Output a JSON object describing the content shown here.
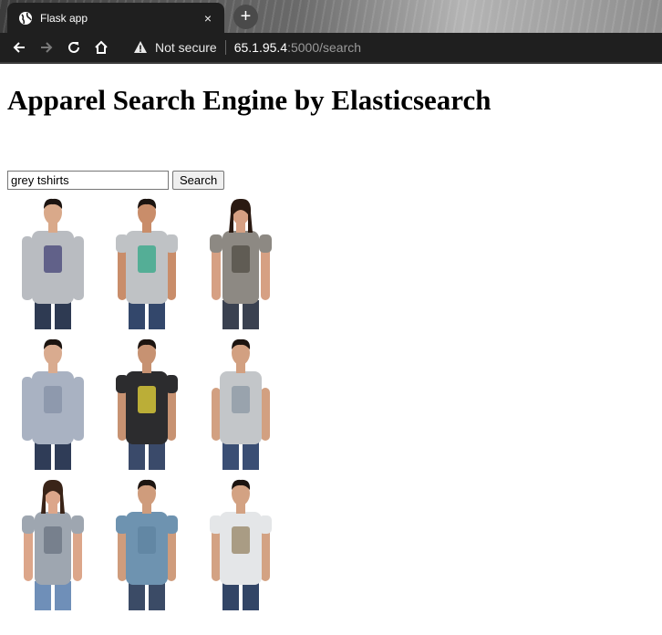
{
  "browser": {
    "tab_title": "Flask app",
    "tab_close": "×",
    "new_tab": "+",
    "security_label": "Not secure",
    "url_host": "65.1.95.4",
    "url_path": ":5000/search"
  },
  "page": {
    "heading": "Apparel Search Engine by Elasticsearch",
    "search": {
      "value": "grey tshirts",
      "button_label": "Search"
    }
  },
  "results": [
    {
      "item": "man-grey-full-sleeve-tee",
      "skin": "#d9a98a",
      "hair": "#1c1410",
      "top": "#b9bcc1",
      "bottom": "#2e3a52",
      "print": "#4b4a7a",
      "sleeve": "long",
      "gender": "m"
    },
    {
      "item": "man-grey-tee-green-graphic",
      "skin": "#c98d6a",
      "hair": "#1c1410",
      "top": "#bfc2c5",
      "bottom": "#33476b",
      "print": "#3aa98a",
      "sleeve": "short",
      "gender": "m"
    },
    {
      "item": "woman-grey-printed-tee",
      "skin": "#d6a083",
      "hair": "#2a1a12",
      "top": "#8d8983",
      "bottom": "#3a4150",
      "print": "#555149",
      "sleeve": "short",
      "gender": "f"
    },
    {
      "item": "man-grey-check-shirt",
      "skin": "#d9ab8f",
      "hair": "#1c1410",
      "top": "#a9b2c2",
      "bottom": "#2f3c57",
      "print": "#8792a8",
      "sleeve": "long",
      "gender": "m"
    },
    {
      "item": "man-black-tee-yellow-graphic",
      "skin": "#c79272",
      "hair": "#1c1410",
      "top": "#2c2c2e",
      "bottom": "#3a4a6a",
      "print": "#e0cf3a",
      "sleeve": "short",
      "gender": "m"
    },
    {
      "item": "man-grey-tank-top",
      "skin": "#d2a081",
      "hair": "#1c1410",
      "top": "#c3c6c9",
      "bottom": "#3a4e74",
      "print": "#8e9aa6",
      "sleeve": "none",
      "gender": "m"
    },
    {
      "item": "woman-grey-floral-tee",
      "skin": "#dca68a",
      "hair": "#3a2418",
      "top": "#9ea6b0",
      "bottom": "#6f8fb8",
      "print": "#6d7785",
      "sleeve": "short",
      "gender": "f"
    },
    {
      "item": "man-blue-grey-polo",
      "skin": "#cf9c7c",
      "hair": "#1c1410",
      "top": "#6e93b0",
      "bottom": "#3b4b66",
      "print": "#5f84a1",
      "sleeve": "short",
      "gender": "m"
    },
    {
      "item": "man-white-tee-ks-print",
      "skin": "#d3a283",
      "hair": "#1c1410",
      "top": "#e4e6e8",
      "bottom": "#324566",
      "print": "#9a8a6a",
      "sleeve": "short",
      "gender": "m"
    }
  ]
}
